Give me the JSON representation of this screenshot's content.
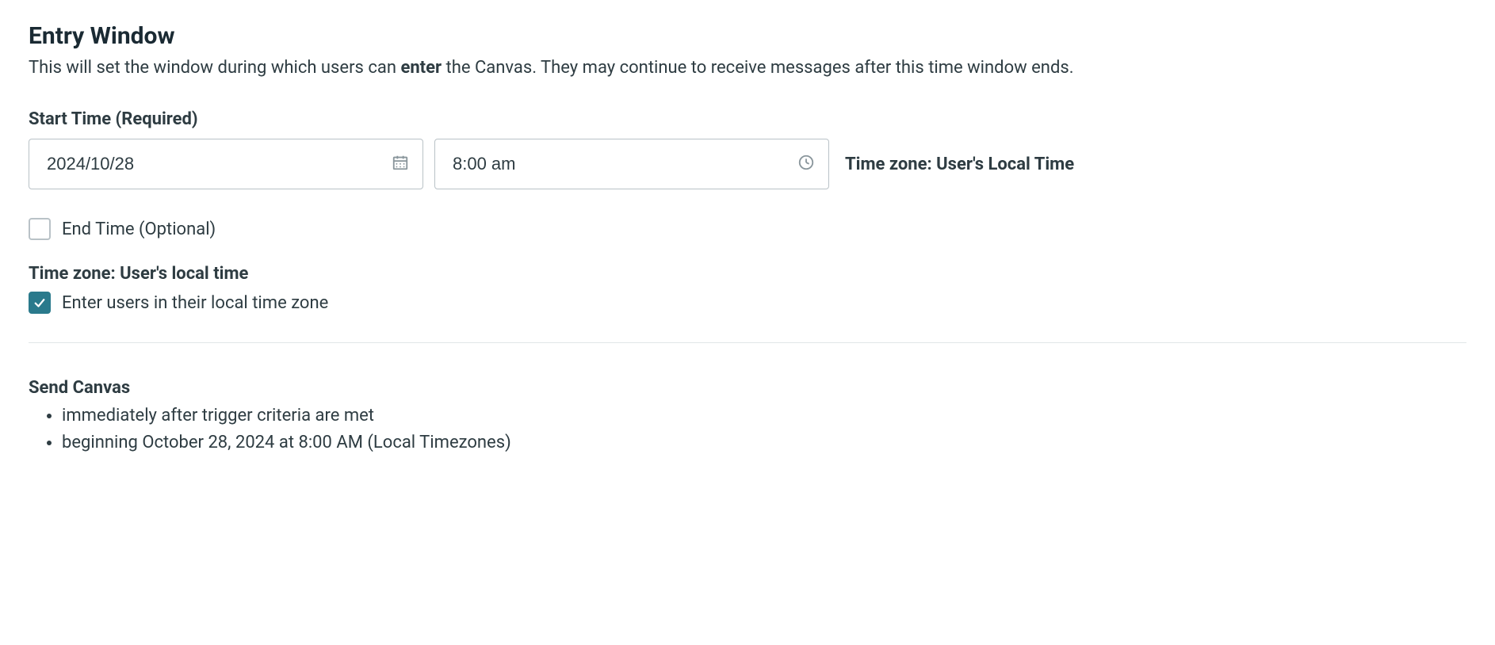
{
  "entryWindow": {
    "title": "Entry Window",
    "descriptionPre": "This will set the window during which users can ",
    "descriptionBold": "enter",
    "descriptionPost": " the Canvas. They may continue to receive messages after this time window ends.",
    "startTimeLabel": "Start Time (Required)",
    "dateValue": "2024/10/28",
    "timeValue": "8:00 am",
    "timezoneInline": "Time zone: User's Local Time",
    "endTimeLabel": "End Time (Optional)",
    "timezoneHeading": "Time zone: User's local time",
    "localTzCheckboxLabel": "Enter users in their local time zone"
  },
  "sendCanvas": {
    "title": "Send Canvas",
    "items": [
      "immediately after trigger criteria are met",
      "beginning October 28, 2024 at 8:00 AM (Local Timezones)"
    ]
  }
}
